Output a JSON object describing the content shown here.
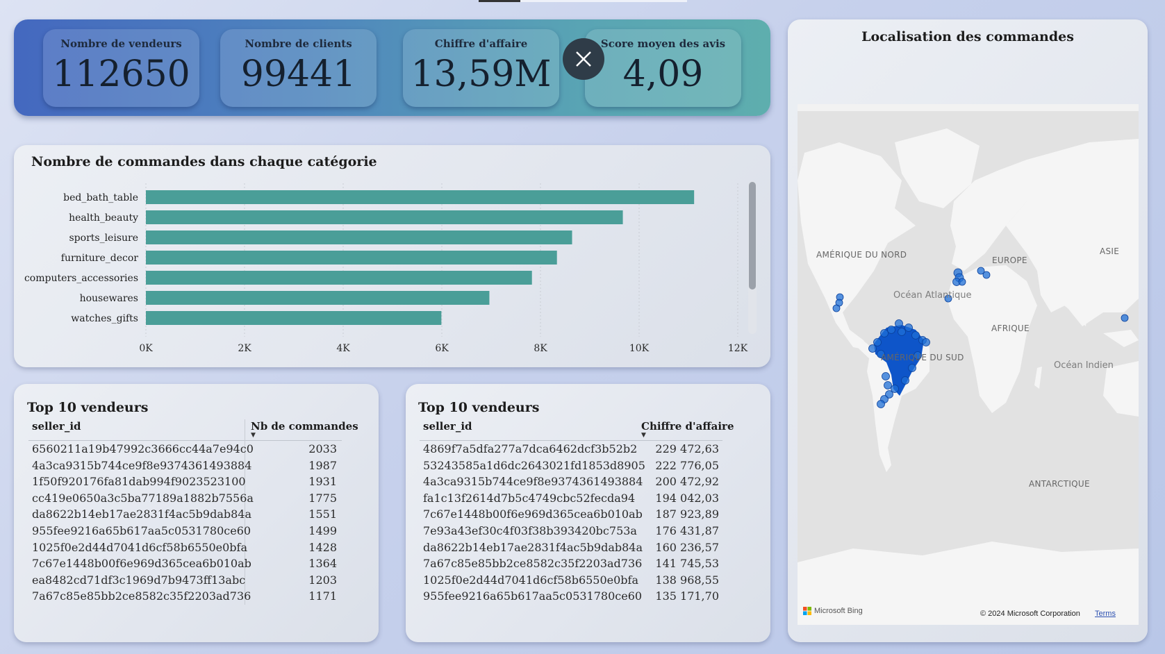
{
  "kpis": [
    {
      "title": "Nombre de vendeurs",
      "value": "112650"
    },
    {
      "title": "Nombre de clients",
      "value": "99441"
    },
    {
      "title": "Chiffre d'affaire",
      "value": "13,59M"
    },
    {
      "title": "Score moyen des avis",
      "value": "4,09"
    }
  ],
  "close_icon": "close-x-icon",
  "category_chart": {
    "title": "Nombre de commandes dans chaque catégorie"
  },
  "chart_data": {
    "type": "bar",
    "orientation": "horizontal",
    "title": "Nombre de commandes dans chaque catégorie",
    "categories": [
      "bed_bath_table",
      "health_beauty",
      "sports_leisure",
      "furniture_decor",
      "computers_accessories",
      "housewares",
      "watches_gifts"
    ],
    "values": [
      11115,
      9670,
      8641,
      8334,
      7827,
      6964,
      5991
    ],
    "xlim": [
      0,
      12000
    ],
    "x_ticks": [
      "0K",
      "2K",
      "4K",
      "6K",
      "8K",
      "10K",
      "12K"
    ],
    "grid": "vertical dotted",
    "bar_color": "#4a9e98"
  },
  "sellers_by_orders": {
    "title": "Top 10 vendeurs",
    "col1": "seller_id",
    "col2": "Nb de commandes",
    "rows": [
      {
        "id": "6560211a19b47992c3666cc44a7e94c0",
        "value": "2033"
      },
      {
        "id": "4a3ca9315b744ce9f8e9374361493884",
        "value": "1987"
      },
      {
        "id": "1f50f920176fa81dab994f9023523100",
        "value": "1931"
      },
      {
        "id": "cc419e0650a3c5ba77189a1882b7556a",
        "value": "1775"
      },
      {
        "id": "da8622b14eb17ae2831f4ac5b9dab84a",
        "value": "1551"
      },
      {
        "id": "955fee9216a65b617aa5c0531780ce60",
        "value": "1499"
      },
      {
        "id": "1025f0e2d44d7041d6cf58b6550e0bfa",
        "value": "1428"
      },
      {
        "id": "7c67e1448b00f6e969d365cea6b010ab",
        "value": "1364"
      },
      {
        "id": "ea8482cd71df3c1969d7b9473ff13abc",
        "value": "1203"
      },
      {
        "id": "7a67c85e85bb2ce8582c35f2203ad736",
        "value": "1171"
      }
    ]
  },
  "sellers_by_revenue": {
    "title": "Top 10 vendeurs",
    "col1": "seller_id",
    "col2": "Chiffre d'affaire",
    "rows": [
      {
        "id": "4869f7a5dfa277a7dca6462dcf3b52b2",
        "value": "229 472,63"
      },
      {
        "id": "53243585a1d6dc2643021fd1853d8905",
        "value": "222 776,05"
      },
      {
        "id": "4a3ca9315b744ce9f8e9374361493884",
        "value": "200 472,92"
      },
      {
        "id": "fa1c13f2614d7b5c4749cbc52fecda94",
        "value": "194 042,03"
      },
      {
        "id": "7c67e1448b00f6e969d365cea6b010ab",
        "value": "187 923,89"
      },
      {
        "id": "7e93a43ef30c4f03f38b393420bc753a",
        "value": "176 431,87"
      },
      {
        "id": "da8622b14eb17ae2831f4ac5b9dab84a",
        "value": "160 236,57"
      },
      {
        "id": "7a67c85e85bb2ce8582c35f2203ad736",
        "value": "141 745,53"
      },
      {
        "id": "1025f0e2d44d7041d6cf58b6550e0bfa",
        "value": "138 968,55"
      },
      {
        "id": "955fee9216a65b617aa5c0531780ce60",
        "value": "135 171,70"
      }
    ]
  },
  "map": {
    "title": "Localisation des commandes",
    "labels": {
      "north_america": "AMÉRIQUE DU NORD",
      "europe": "EUROPE",
      "asia": "ASIE",
      "atlantic": "Océan Atlantique",
      "africa": "AFRIQUE",
      "south_america": "AMÉRIQUE DU SUD",
      "indian_ocean": "Océan Indien",
      "antarctica": "ANTARCTIQUE"
    },
    "brand": "Microsoft Bing",
    "copyright": "© 2024 Microsoft Corporation",
    "terms": "Terms",
    "marker_color": "#1f6fd6"
  }
}
